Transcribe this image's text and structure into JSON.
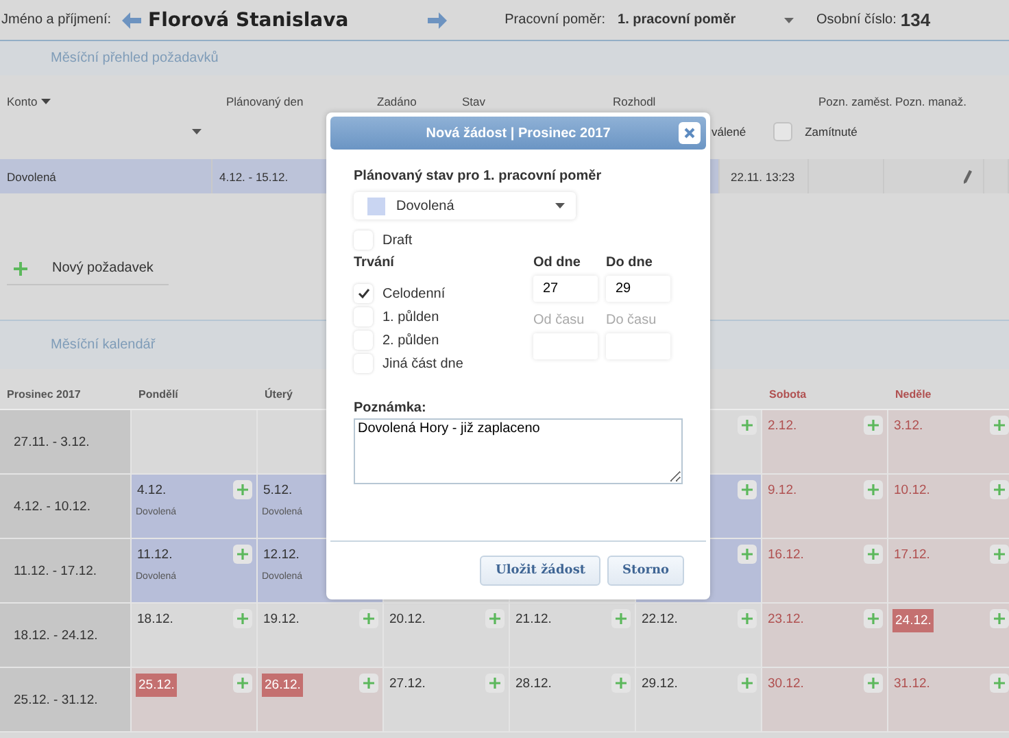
{
  "header": {
    "name_label": "Jméno a příjmení:",
    "name": "Florová Stanislava",
    "employment_label": "Pracovní poměr:",
    "employment": "1. pracovní poměr",
    "number_label": "Osobní číslo:",
    "number": "134"
  },
  "requests_section": {
    "title": "Měsíční přehled požadavků"
  },
  "requests_table": {
    "columns": [
      "Konto",
      "Plánovaný den",
      "Zadáno",
      "Stav",
      "Rozhodl",
      "Pozn. zaměst.",
      "Pozn. manaž."
    ],
    "filters": {
      "approved_label": "válené",
      "rejected": {
        "label": "Zamítnuté",
        "checked": false
      }
    },
    "rows": [
      {
        "konto": "Dovolená",
        "planned": "4.12. - 15.12.",
        "decided_at": "22.11. 13:23"
      }
    ]
  },
  "new_request": {
    "label": "Nový požadavek"
  },
  "calendar_section": {
    "title": "Měsíční kalendář"
  },
  "calendar": {
    "month": "Prosinec 2017",
    "weekdays": [
      {
        "kind": "workday",
        "label": "Pondělí"
      },
      {
        "kind": "workday",
        "label": "Úterý"
      },
      {
        "kind": "covered"
      },
      {
        "kind": "covered"
      },
      {
        "kind": "covered"
      },
      {
        "kind": "weekend",
        "label": "Sobota"
      },
      {
        "kind": "weekend",
        "label": "Neděle"
      }
    ],
    "weeks": [
      {
        "label": "27.11. - 3.12.",
        "days": [
          {
            "kind": "work",
            "add": false,
            "vacation": false
          },
          {
            "kind": "work",
            "vacation": false
          },
          {
            "kind": "covered"
          },
          {
            "kind": "covered"
          },
          {
            "kind": "work",
            "add": true,
            "vacation": false
          },
          {
            "kind": "weekend",
            "date": "2.12.",
            "add": true,
            "holiday": false,
            "vacation": false
          },
          {
            "kind": "weekend",
            "date": "3.12.",
            "add": true,
            "holiday": false,
            "vacation": false
          }
        ]
      },
      {
        "label": "4.12. - 10.12.",
        "days": [
          {
            "kind": "work",
            "date": "4.12.",
            "note": "Dovolená",
            "add": true,
            "holiday": false,
            "vacation": true
          },
          {
            "kind": "work",
            "date": "5.12.",
            "note": "Dovolená",
            "holiday": false,
            "vacation": true
          },
          {
            "kind": "covered"
          },
          {
            "kind": "covered"
          },
          {
            "kind": "work",
            "add": true,
            "vacation": true
          },
          {
            "kind": "weekend",
            "date": "9.12.",
            "add": true,
            "holiday": false,
            "vacation": false
          },
          {
            "kind": "weekend",
            "date": "10.12.",
            "add": true,
            "holiday": false,
            "vacation": false
          }
        ]
      },
      {
        "label": "11.12. - 17.12.",
        "days": [
          {
            "kind": "work",
            "date": "11.12.",
            "note": "Dovolená",
            "add": true,
            "holiday": false,
            "vacation": true
          },
          {
            "kind": "work",
            "date": "12.12.",
            "note": "Dovolená",
            "holiday": false,
            "vacation": true
          },
          {
            "kind": "covered"
          },
          {
            "kind": "covered"
          },
          {
            "kind": "work",
            "add": true,
            "vacation": true
          },
          {
            "kind": "weekend",
            "date": "16.12.",
            "add": true,
            "holiday": false,
            "vacation": false
          },
          {
            "kind": "weekend",
            "date": "17.12.",
            "add": true,
            "holiday": false,
            "vacation": false
          }
        ]
      },
      {
        "label": "18.12. - 24.12.",
        "days": [
          {
            "kind": "work",
            "date": "18.12.",
            "add": true,
            "holiday": false,
            "vacation": false
          },
          {
            "kind": "work",
            "date": "19.12.",
            "add": true,
            "holiday": false,
            "vacation": false
          },
          {
            "kind": "work",
            "date": "20.12.",
            "add": true,
            "holiday": false,
            "vacation": false
          },
          {
            "kind": "work",
            "date": "21.12.",
            "add": true,
            "holiday": false,
            "vacation": false
          },
          {
            "kind": "work",
            "date": "22.12.",
            "add": true,
            "holiday": false,
            "vacation": false
          },
          {
            "kind": "weekend",
            "date": "23.12.",
            "add": true,
            "holiday": false,
            "vacation": false
          },
          {
            "kind": "weekend",
            "date": "24.12.",
            "add": true,
            "holiday": true,
            "vacation": false
          }
        ]
      },
      {
        "label": "25.12. - 31.12.",
        "days": [
          {
            "kind": "weekend",
            "date": "25.12.",
            "add": true,
            "holiday": true,
            "vacation": false
          },
          {
            "kind": "weekend",
            "date": "26.12.",
            "add": true,
            "holiday": true,
            "vacation": false
          },
          {
            "kind": "work",
            "date": "27.12.",
            "add": true,
            "holiday": false,
            "vacation": false
          },
          {
            "kind": "work",
            "date": "28.12.",
            "add": true,
            "holiday": false,
            "vacation": false
          },
          {
            "kind": "work",
            "date": "29.12.",
            "add": true,
            "holiday": false,
            "vacation": false
          },
          {
            "kind": "weekend",
            "date": "30.12.",
            "add": true,
            "holiday": false,
            "vacation": false
          },
          {
            "kind": "weekend",
            "date": "31.12.",
            "add": true,
            "holiday": false,
            "vacation": false
          }
        ]
      }
    ]
  },
  "dialog": {
    "title": "Nová žádost | Prosinec 2017",
    "state_label": "Plánovaný stav pro 1. pracovní poměr",
    "state": {
      "value": "Dovolená",
      "color": "#c9d5f2"
    },
    "draft": {
      "label": "Draft",
      "checked": false
    },
    "duration": {
      "label": "Trvání",
      "options": [
        {
          "label": "Celodenní",
          "checked": true
        },
        {
          "label": "1. půlden",
          "checked": false
        },
        {
          "label": "2. půlden",
          "checked": false
        },
        {
          "label": "Jiná část dne",
          "checked": false
        }
      ]
    },
    "from_day": {
      "label": "Od dne",
      "value": "27"
    },
    "to_day": {
      "label": "Do dne",
      "value": "29"
    },
    "from_time": {
      "label": "Od času",
      "disabled": true
    },
    "to_time": {
      "label": "Do času",
      "disabled": true
    },
    "note": {
      "label": "Poznámka:",
      "value": "Dovolená Hory - již zaplaceno"
    },
    "buttons": [
      "Uložit žádost",
      "Storno"
    ]
  }
}
